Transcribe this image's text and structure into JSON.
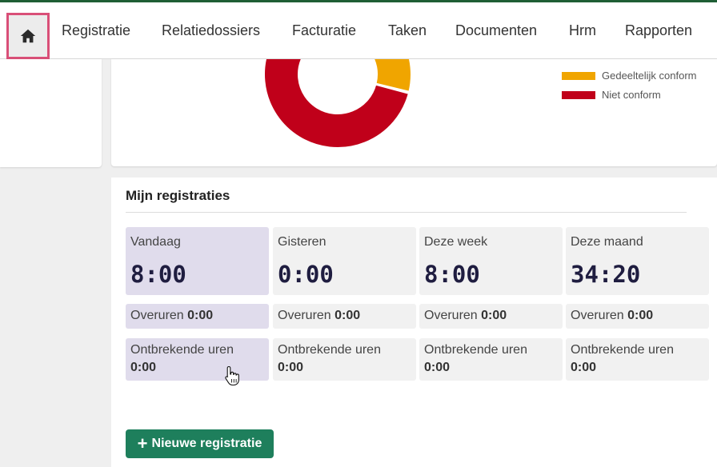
{
  "nav": {
    "home_icon": "home-icon",
    "items": [
      "Registratie",
      "Relatiedossiers",
      "Facturatie",
      "Taken",
      "Documenten",
      "Hrm",
      "Rapporten"
    ]
  },
  "chart": {
    "legend": [
      {
        "label": "Gedeeltelijk conform",
        "color": "#f0a500"
      },
      {
        "label": "Niet conform",
        "color": "#c0001a"
      }
    ]
  },
  "chart_data": {
    "type": "pie",
    "variant": "donut",
    "series": [
      {
        "name": "Gedeeltelijk conform",
        "value": 0.11,
        "color": "#f0a500"
      },
      {
        "name": "Niet conform",
        "value": 0.89,
        "color": "#c0001a"
      }
    ]
  },
  "registrations": {
    "title": "Mijn registraties",
    "periods": [
      {
        "label": "Vandaag",
        "value": "8:00",
        "overtime_label": "Overuren",
        "overtime_value": "0:00",
        "missing_label": "Ontbrekende uren",
        "missing_value": "0:00"
      },
      {
        "label": "Gisteren",
        "value": "0:00",
        "overtime_label": "Overuren",
        "overtime_value": "0:00",
        "missing_label": "Ontbrekende uren",
        "missing_value": "0:00"
      },
      {
        "label": "Deze week",
        "value": "8:00",
        "overtime_label": "Overuren",
        "overtime_value": "0:00",
        "missing_label": "Ontbrekende uren",
        "missing_value": "0:00"
      },
      {
        "label": "Deze maand",
        "value": "34:20",
        "overtime_label": "Overuren",
        "overtime_value": "0:00",
        "missing_label": "Ontbrekende uren",
        "missing_value": "0:00"
      }
    ],
    "new_button": "Nieuwe registratie"
  },
  "colors": {
    "accent": "#1e7f5c",
    "active_tile": "#e0dcec",
    "topbar": "#1f5e35"
  }
}
